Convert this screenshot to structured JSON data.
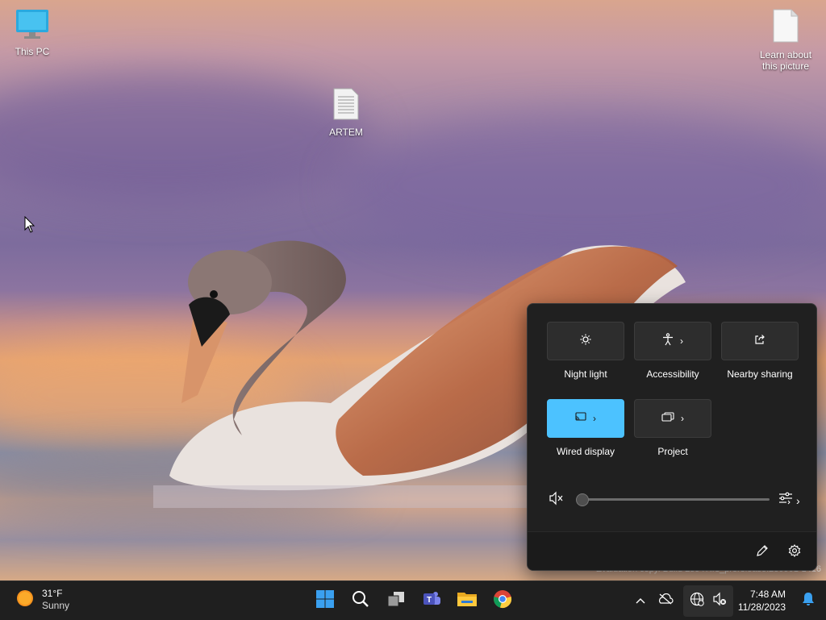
{
  "desktop": {
    "icons": [
      {
        "label": "This PC"
      },
      {
        "label": "ARTEM"
      },
      {
        "label": "Learn about this picture"
      }
    ],
    "watermark": "Evaluation copy. Build 25947.rs_prerelease.230901-1416"
  },
  "quick_settings": {
    "tiles": [
      {
        "label": "Night light",
        "icon": "brightness-icon",
        "active": false
      },
      {
        "label": "Accessibility",
        "icon": "accessibility-icon",
        "active": false,
        "chevron": true
      },
      {
        "label": "Nearby sharing",
        "icon": "share-icon",
        "active": false
      },
      {
        "label": "Wired display",
        "icon": "cast-icon",
        "active": true,
        "chevron": true
      },
      {
        "label": "Project",
        "icon": "project-icon",
        "active": false,
        "chevron": true
      }
    ],
    "volume": {
      "level": 0,
      "muted": true
    },
    "accent_color": "#4cc2ff"
  },
  "taskbar": {
    "weather": {
      "temp": "31°F",
      "condition": "Sunny"
    },
    "apps": [
      "start-icon",
      "search-icon",
      "task-view-icon",
      "teams-icon",
      "file-explorer-icon",
      "chrome-icon"
    ],
    "clock": {
      "time": "7:48 AM",
      "date": "11/28/2023"
    }
  }
}
